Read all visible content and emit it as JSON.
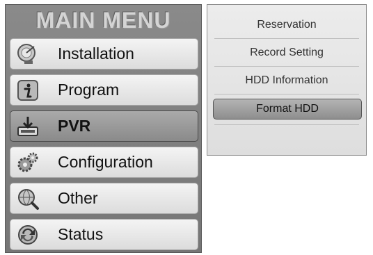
{
  "main_menu": {
    "title": "MAIN MENU",
    "items": [
      {
        "label": "Installation",
        "icon": "satellite-dish-icon",
        "selected": false
      },
      {
        "label": "Program",
        "icon": "info-icon",
        "selected": false
      },
      {
        "label": "PVR",
        "icon": "pvr-download-icon",
        "selected": true
      },
      {
        "label": "Configuration",
        "icon": "gears-icon",
        "selected": false
      },
      {
        "label": "Other",
        "icon": "globe-search-icon",
        "selected": false
      },
      {
        "label": "Status",
        "icon": "status-arrows-icon",
        "selected": false
      }
    ]
  },
  "sub_menu": {
    "items": [
      {
        "label": "Reservation",
        "selected": false
      },
      {
        "label": "Record Setting",
        "selected": false
      },
      {
        "label": "HDD Information",
        "selected": false
      },
      {
        "label": "Format HDD",
        "selected": true
      }
    ]
  }
}
